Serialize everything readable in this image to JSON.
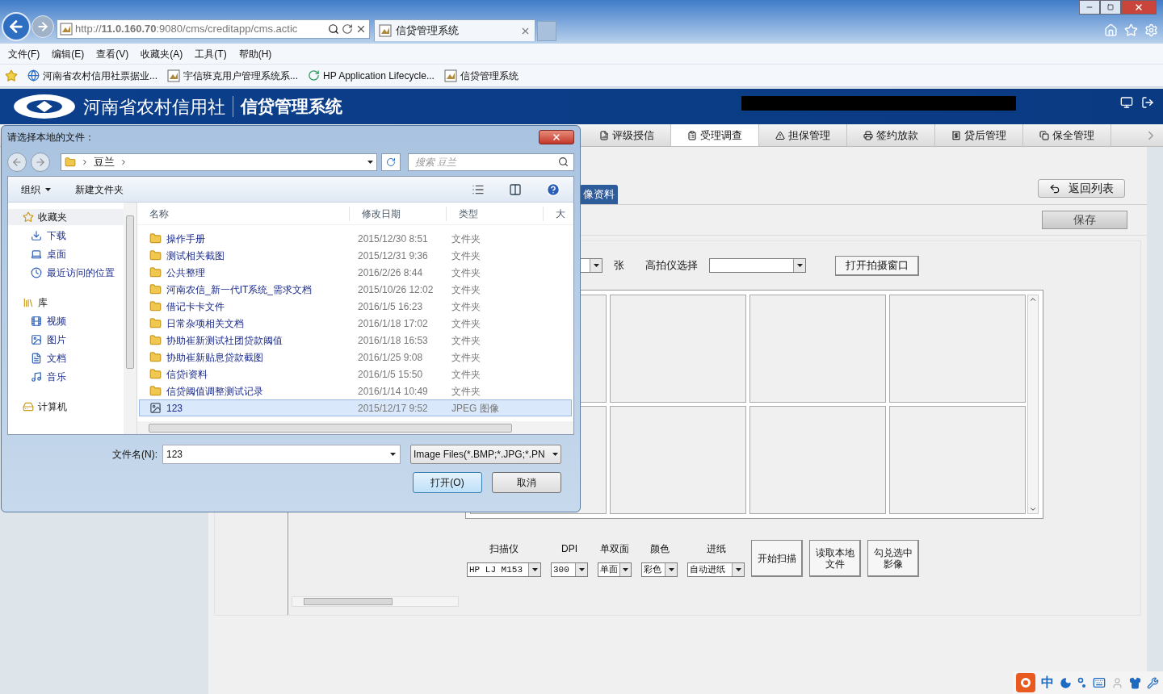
{
  "browser": {
    "address": "http://**11.0.160.70**:9080/cms/creditapp/cms.actic",
    "tabs": [
      {
        "title": "信贷管理系统",
        "selected": true
      }
    ],
    "menu": [
      "文件(F)",
      "编辑(E)",
      "查看(V)",
      "收藏夹(A)",
      "工具(T)",
      "帮助(H)"
    ],
    "favorites": [
      {
        "label": "河南省农村信用社票据业...",
        "kind": "ie"
      },
      {
        "label": "宇信班克用户管理系统系...",
        "kind": "page"
      },
      {
        "label": "HP Application Lifecycle...",
        "kind": "hp"
      },
      {
        "label": "信贷管理系统",
        "kind": "page"
      }
    ]
  },
  "app": {
    "org_name": "河南省农村信用社",
    "system_name": "信贷管理系统",
    "nav_tabs": [
      {
        "label": "评级授信",
        "kind": "rating",
        "selected": false
      },
      {
        "label": "受理调查",
        "kind": "survey",
        "selected": true
      },
      {
        "label": "担保管理",
        "kind": "guarantee",
        "selected": false
      },
      {
        "label": "签约放款",
        "kind": "contract",
        "selected": false
      },
      {
        "label": "贷后管理",
        "kind": "postloan",
        "selected": false
      },
      {
        "label": "保全管理",
        "kind": "preserve",
        "selected": false
      }
    ]
  },
  "content": {
    "tab": "像资料",
    "back_button": "返回列表",
    "save_button": "保存",
    "count_unit": "张",
    "camera_label": "高拍仪选择",
    "open_camera_button": "打开拍摄窗口",
    "scan_options": [
      {
        "label": "扫描仪",
        "value": "HP LJ M153"
      },
      {
        "label": "DPI",
        "value": "300"
      },
      {
        "label": "单双面",
        "value": "单面"
      },
      {
        "label": "颜色",
        "value": "彩色"
      },
      {
        "label": "进纸",
        "value": "自动进纸"
      }
    ],
    "scan_buttons": [
      "开始扫描",
      "读取本地文件",
      "勾兑选中影像"
    ]
  },
  "dialog": {
    "title": "请选择本地的文件：",
    "breadcrumb": "豆兰",
    "search_placeholder": "搜索 豆兰",
    "organize": "组织",
    "new_folder": "新建文件夹",
    "sidebar": [
      {
        "label": "收藏夹",
        "kind": "favorites",
        "children": [
          {
            "label": "下载",
            "kind": "download"
          },
          {
            "label": "桌面",
            "kind": "desktop"
          },
          {
            "label": "最近访问的位置",
            "kind": "recent"
          }
        ]
      },
      {
        "label": "库",
        "kind": "library",
        "children": [
          {
            "label": "视频",
            "kind": "video"
          },
          {
            "label": "图片",
            "kind": "pictures"
          },
          {
            "label": "文档",
            "kind": "documents"
          },
          {
            "label": "音乐",
            "kind": "music"
          }
        ]
      },
      {
        "label": "计算机",
        "kind": "computer"
      }
    ],
    "columns": [
      "名称",
      "修改日期",
      "类型",
      "大"
    ],
    "files": [
      {
        "name": "操作手册",
        "date": "2015/12/30 8:51",
        "type": "文件夹",
        "kind": "folder",
        "selected": false
      },
      {
        "name": "测试相关截图",
        "date": "2015/12/31 9:36",
        "type": "文件夹",
        "kind": "folder",
        "selected": false
      },
      {
        "name": "公共整理",
        "date": "2016/2/26 8:44",
        "type": "文件夹",
        "kind": "folder",
        "selected": false
      },
      {
        "name": "河南农信_新一代IT系统_需求文档",
        "date": "2015/10/26 12:02",
        "type": "文件夹",
        "kind": "folder",
        "selected": false
      },
      {
        "name": "借记卡卡文件",
        "date": "2016/1/5 16:23",
        "type": "文件夹",
        "kind": "folder",
        "selected": false
      },
      {
        "name": "日常杂项相关文档",
        "date": "2016/1/18 17:02",
        "type": "文件夹",
        "kind": "folder",
        "selected": false
      },
      {
        "name": "协助崔新测试社团贷款阈值",
        "date": "2016/1/18 16:53",
        "type": "文件夹",
        "kind": "folder",
        "selected": false
      },
      {
        "name": "协助崔新贴息贷款截图",
        "date": "2016/1/25 9:08",
        "type": "文件夹",
        "kind": "folder",
        "selected": false
      },
      {
        "name": "信贷i资料",
        "date": "2016/1/5 15:50",
        "type": "文件夹",
        "kind": "folder",
        "selected": false
      },
      {
        "name": "信贷阈值调整测试记录",
        "date": "2016/1/14 10:49",
        "type": "文件夹",
        "kind": "folder",
        "selected": false
      },
      {
        "name": "123",
        "date": "2015/12/17 9:52",
        "type": "JPEG 图像",
        "kind": "image",
        "selected": true
      }
    ],
    "filename_label": "文件名(N):",
    "filename": "123",
    "filetype": "Image Files(*.BMP;*.JPG;*.PN",
    "open_button": "打开(O)",
    "cancel_button": "取消"
  },
  "ime": {
    "mode": "中"
  }
}
